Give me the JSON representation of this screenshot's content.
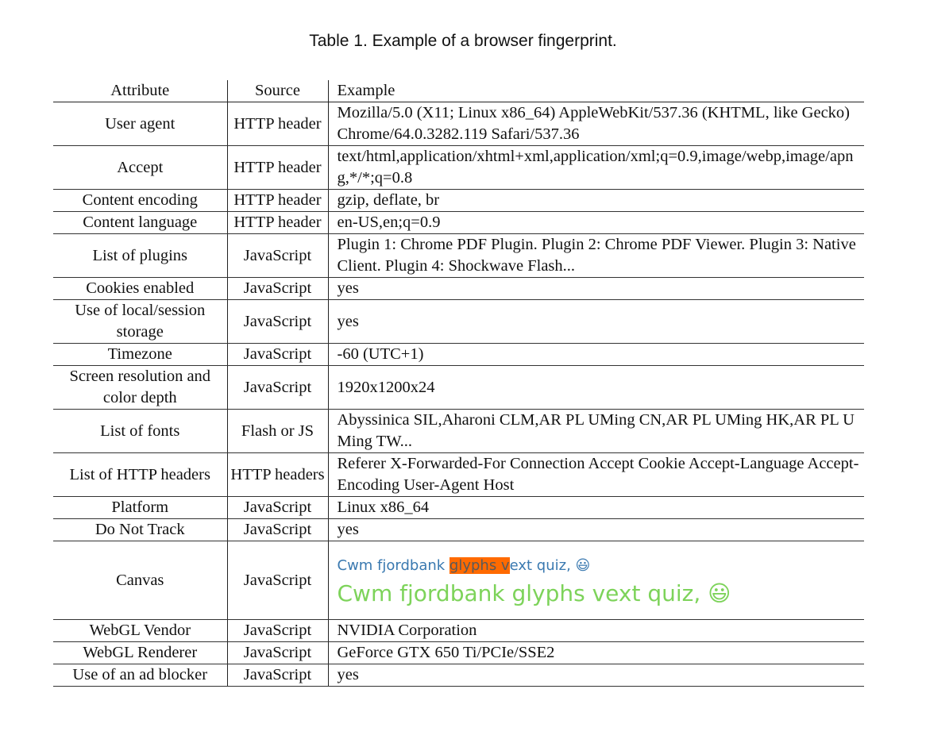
{
  "caption": "Table 1.  Example of a browser fingerprint.",
  "headers": {
    "attribute": "Attribute",
    "source": "Source",
    "example": "Example"
  },
  "rows": [
    {
      "attribute": "User agent",
      "source": "HTTP header",
      "example": "Mozilla/5.0 (X11; Linux x86_64) AppleWebKit/537.36 (KHTML, like Gecko) Chrome/64.0.3282.119 Safari/537.36"
    },
    {
      "attribute": "Accept",
      "source": "HTTP header",
      "example": "text/html,application/xhtml+xml,application/xml;q=0.9,image/webp,image/apng,*/*;q=0.8"
    },
    {
      "attribute": "Content encoding",
      "source": "HTTP header",
      "example": "gzip, deflate, br"
    },
    {
      "attribute": "Content language",
      "source": "HTTP header",
      "example": "en-US,en;q=0.9"
    },
    {
      "attribute": "List of plugins",
      "source": "JavaScript",
      "example": "Plugin 1: Chrome PDF Plugin. Plugin 2: Chrome PDF Viewer. Plugin 3: Native Client. Plugin 4: Shockwave Flash..."
    },
    {
      "attribute": "Cookies enabled",
      "source": "JavaScript",
      "example": "yes"
    },
    {
      "attribute": "Use of local/session storage",
      "source": "JavaScript",
      "example": "yes"
    },
    {
      "attribute": "Timezone",
      "source": "JavaScript",
      "example": "-60 (UTC+1)"
    },
    {
      "attribute": "Screen resolution and color depth",
      "source": "JavaScript",
      "example": "1920x1200x24"
    },
    {
      "attribute": "List of fonts",
      "source": "Flash or JS",
      "example": "Abyssinica SIL,Aharoni CLM,AR PL UMing CN,AR PL UMing HK,AR PL UMing TW..."
    },
    {
      "attribute": "List of HTTP headers",
      "source": "HTTP headers",
      "example": "Referer X-Forwarded-For Connection Accept Cookie Accept-Language Accept-Encoding User-Agent Host"
    },
    {
      "attribute": "Platform",
      "source": "JavaScript",
      "example": "Linux x86_64"
    },
    {
      "attribute": "Do Not Track",
      "source": "JavaScript",
      "example": "yes"
    }
  ],
  "canvas_row": {
    "attribute": "Canvas",
    "source": "JavaScript",
    "line1_before": "Cwm fjordbank ",
    "line1_highlight": "glyphs v",
    "line1_after": "ext quiz, 😃",
    "line2": "Cwm fjordbank glyphs vext quiz, 😃",
    "highlight_color": "#ff6a00",
    "line1_color": "#3a79b0",
    "line2_color": "#7dd35a"
  },
  "rows_after": [
    {
      "attribute": "WebGL Vendor",
      "source": "JavaScript",
      "example": "NVIDIA Corporation"
    },
    {
      "attribute": "WebGL Renderer",
      "source": "JavaScript",
      "example": "GeForce GTX 650 Ti/PCIe/SSE2"
    },
    {
      "attribute": "Use of an ad blocker",
      "source": "JavaScript",
      "example": "yes"
    }
  ]
}
